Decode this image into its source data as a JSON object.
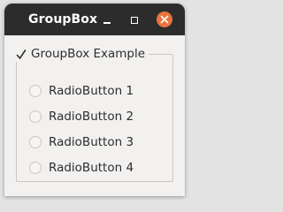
{
  "window": {
    "title": "GroupBox",
    "buttons": {
      "minimize_icon": "minimize-icon",
      "maximize_icon": "maximize-icon",
      "close_icon": "close-icon",
      "close_color": "#e9743f"
    }
  },
  "groupbox": {
    "title": "GroupBox Example",
    "checked": true,
    "radios": [
      {
        "label": "RadioButton 1",
        "checked": false
      },
      {
        "label": "RadioButton 2",
        "checked": false
      },
      {
        "label": "RadioButton 3",
        "checked": false
      },
      {
        "label": "RadioButton 4",
        "checked": false
      }
    ]
  }
}
